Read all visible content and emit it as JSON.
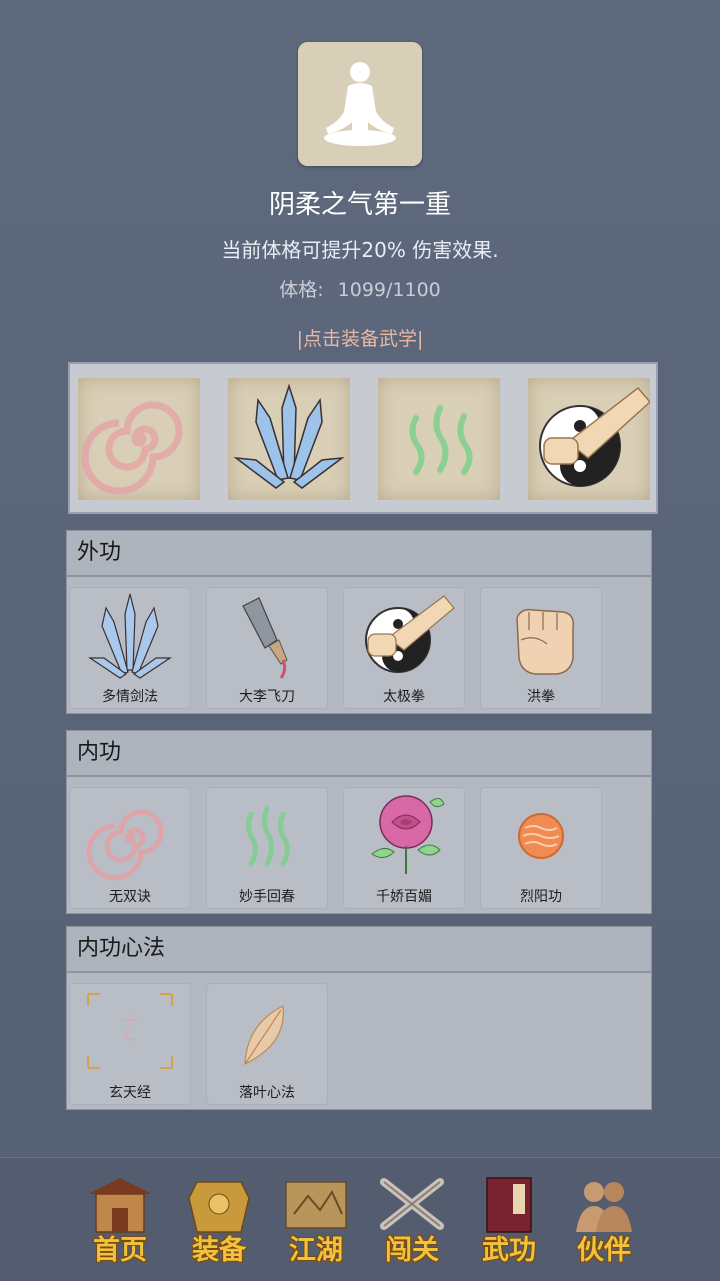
{
  "header": {
    "title": "阴柔之气第一重",
    "description": "当前体格可提升20% 伤害效果.",
    "stat_label": "体格:",
    "stat_value": "1099/1100",
    "equip_hint": "|点击装备武学|"
  },
  "equipped_icons": [
    "spiral-icon",
    "sword-blades-icon",
    "green-waves-icon",
    "taiji-fist-icon"
  ],
  "sections": [
    {
      "title": "外功",
      "items": [
        {
          "name": "多情剑法",
          "icon": "sword-blades-icon"
        },
        {
          "name": "大李飞刀",
          "icon": "cleaver-icon"
        },
        {
          "name": "太极拳",
          "icon": "taiji-fist-icon"
        },
        {
          "name": "洪拳",
          "icon": "fist-icon"
        }
      ]
    },
    {
      "title": "内功",
      "items": [
        {
          "name": "无双诀",
          "icon": "spiral-icon"
        },
        {
          "name": "妙手回春",
          "icon": "green-waves-icon"
        },
        {
          "name": "千娇百媚",
          "icon": "rose-icon"
        },
        {
          "name": "烈阳功",
          "icon": "sun-icon"
        }
      ]
    },
    {
      "title": "内功心法",
      "items": [
        {
          "name": "玄天经",
          "icon": "scroll-glyph-icon"
        },
        {
          "name": "落叶心法",
          "icon": "leaf-icon"
        }
      ]
    }
  ],
  "nav": [
    {
      "label": "首页",
      "icon": "house-icon"
    },
    {
      "label": "装备",
      "icon": "armor-icon"
    },
    {
      "label": "江湖",
      "icon": "map-icon"
    },
    {
      "label": "闯关",
      "icon": "swords-icon"
    },
    {
      "label": "武功",
      "icon": "book-icon"
    },
    {
      "label": "伙伴",
      "icon": "partners-icon"
    }
  ]
}
